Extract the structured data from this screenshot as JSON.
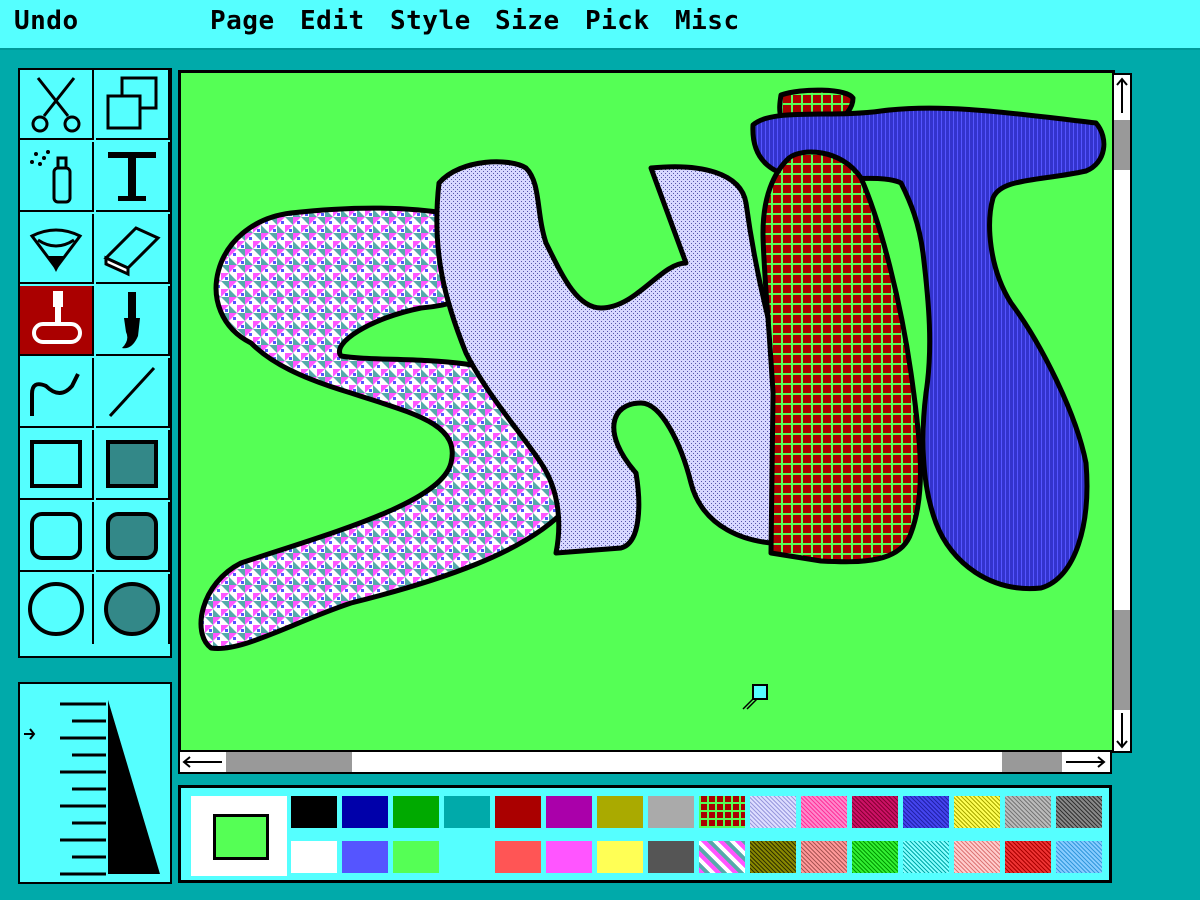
{
  "menu": {
    "undo": "Undo",
    "page": "Page",
    "edit": "Edit",
    "style": "Style",
    "size": "Size",
    "pick": "Pick",
    "misc": "Misc"
  },
  "tools": [
    {
      "name": "scissors",
      "icon": "scissors-icon",
      "selected": false
    },
    {
      "name": "select-rect",
      "icon": "overlap-rectangles-icon",
      "selected": false
    },
    {
      "name": "spray-can",
      "icon": "spray-can-icon",
      "selected": false
    },
    {
      "name": "text",
      "icon": "text-t-icon",
      "selected": false
    },
    {
      "name": "fill",
      "icon": "paint-bucket-icon",
      "selected": false
    },
    {
      "name": "eraser",
      "icon": "eraser-icon",
      "selected": false
    },
    {
      "name": "paint-roller",
      "icon": "paint-roller-icon",
      "selected": true
    },
    {
      "name": "brush",
      "icon": "paintbrush-icon",
      "selected": false
    },
    {
      "name": "curve",
      "icon": "curve-icon",
      "selected": false
    },
    {
      "name": "line",
      "icon": "line-icon",
      "selected": false
    },
    {
      "name": "rectangle",
      "icon": "rectangle-icon",
      "selected": false
    },
    {
      "name": "filled-rectangle",
      "icon": "filled-rectangle-icon",
      "selected": false
    },
    {
      "name": "rounded-rectangle",
      "icon": "rounded-rectangle-icon",
      "selected": false
    },
    {
      "name": "filled-rounded-rectangle",
      "icon": "filled-rounded-rectangle-icon",
      "selected": false
    },
    {
      "name": "ellipse",
      "icon": "ellipse-icon",
      "selected": false
    },
    {
      "name": "filled-ellipse",
      "icon": "filled-ellipse-icon",
      "selected": false
    }
  ],
  "colors": {
    "background": "#00aaaa",
    "panel": "#55ffff",
    "canvas": "#55ff55",
    "selected_tool": "#aa0000",
    "current_fill": "#55ff55"
  },
  "palette_row1": [
    "#000000",
    "#0000aa",
    "#00aa00",
    "#00aaaa",
    "#aa0000",
    "#aa00aa",
    "#aaaa00",
    "#aaaaaa",
    "pattern-red-green",
    "pattern-lavender",
    "pattern-pink",
    "pattern-crimson",
    "pattern-blue",
    "pattern-yellow",
    "pattern-gray",
    "pattern-darkgray"
  ],
  "palette_row2": [
    "#ffffff",
    "#5555ff",
    "#55ff55",
    "#55ffff",
    "#ff5555",
    "#ff55ff",
    "#ffff55",
    "#555555",
    "pattern-multicolor",
    "pattern-olive",
    "pattern-rose",
    "pattern-green",
    "pattern-cyan",
    "pattern-salmon",
    "pattern-red",
    "pattern-skyblue"
  ],
  "canvas_art": "hand-drawn filled blob shapes"
}
